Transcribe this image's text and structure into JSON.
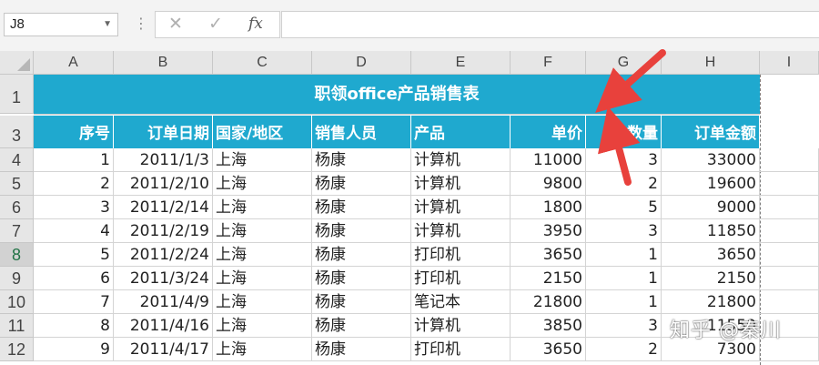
{
  "formula_bar": {
    "name_box": "J8",
    "cancel_icon": "✕",
    "enter_icon": "✓",
    "fx_label": "fx",
    "formula": ""
  },
  "columns": [
    "A",
    "B",
    "C",
    "D",
    "E",
    "F",
    "G",
    "H",
    "I"
  ],
  "rows": [
    "1",
    "3",
    "4",
    "5",
    "6",
    "7",
    "8",
    "9",
    "10",
    "11",
    "12"
  ],
  "selected_row": "8",
  "sheet": {
    "title": "职领office产品销售表",
    "headers": [
      "序号",
      "订单日期",
      "国家/地区",
      "销售人员",
      "产品",
      "单价",
      "数量",
      "订单金额"
    ],
    "records": [
      [
        "1",
        "2011/1/3",
        "上海",
        "杨康",
        "计算机",
        "11000",
        "3",
        "33000"
      ],
      [
        "2",
        "2011/2/10",
        "上海",
        "杨康",
        "计算机",
        "9800",
        "2",
        "19600"
      ],
      [
        "3",
        "2011/2/14",
        "上海",
        "杨康",
        "计算机",
        "1800",
        "5",
        "9000"
      ],
      [
        "4",
        "2011/2/19",
        "上海",
        "杨康",
        "计算机",
        "3950",
        "3",
        "11850"
      ],
      [
        "5",
        "2011/2/24",
        "上海",
        "杨康",
        "打印机",
        "3650",
        "1",
        "3650"
      ],
      [
        "6",
        "2011/3/24",
        "上海",
        "杨康",
        "打印机",
        "2150",
        "1",
        "2150"
      ],
      [
        "7",
        "2011/4/9",
        "上海",
        "杨康",
        "笔记本",
        "21800",
        "1",
        "21800"
      ],
      [
        "8",
        "2011/4/16",
        "上海",
        "杨康",
        "计算机",
        "3850",
        "3",
        "11550"
      ],
      [
        "9",
        "2011/4/17",
        "上海",
        "杨康",
        "打印机",
        "3650",
        "2",
        "7300"
      ]
    ]
  },
  "watermark": "知乎 @秦川",
  "colors": {
    "header_fill": "#1fa9cf",
    "arrow": "#e8413c",
    "selected_row": "#217346"
  }
}
